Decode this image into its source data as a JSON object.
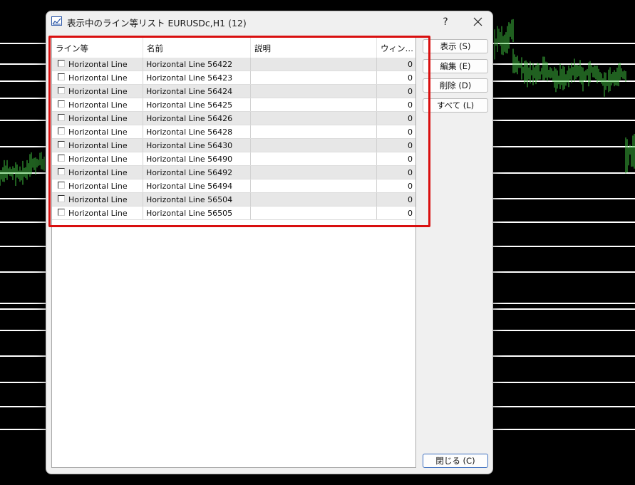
{
  "window": {
    "title": "表示中のライン等リスト EURUSDc,H1 (12)",
    "help_label": "?",
    "icon": "chart-window-icon",
    "close_icon": "close-icon"
  },
  "table": {
    "columns": [
      "ライン等",
      "名前",
      "説明",
      "ウィン…"
    ],
    "rows": [
      {
        "type": "Horizontal Line",
        "name": "Horizontal Line 56422",
        "desc": "",
        "window": "0"
      },
      {
        "type": "Horizontal Line",
        "name": "Horizontal Line 56423",
        "desc": "",
        "window": "0"
      },
      {
        "type": "Horizontal Line",
        "name": "Horizontal Line 56424",
        "desc": "",
        "window": "0"
      },
      {
        "type": "Horizontal Line",
        "name": "Horizontal Line 56425",
        "desc": "",
        "window": "0"
      },
      {
        "type": "Horizontal Line",
        "name": "Horizontal Line 56426",
        "desc": "",
        "window": "0"
      },
      {
        "type": "Horizontal Line",
        "name": "Horizontal Line 56428",
        "desc": "",
        "window": "0"
      },
      {
        "type": "Horizontal Line",
        "name": "Horizontal Line 56430",
        "desc": "",
        "window": "0"
      },
      {
        "type": "Horizontal Line",
        "name": "Horizontal Line 56490",
        "desc": "",
        "window": "0"
      },
      {
        "type": "Horizontal Line",
        "name": "Horizontal Line 56492",
        "desc": "",
        "window": "0"
      },
      {
        "type": "Horizontal Line",
        "name": "Horizontal Line 56494",
        "desc": "",
        "window": "0"
      },
      {
        "type": "Horizontal Line",
        "name": "Horizontal Line 56504",
        "desc": "",
        "window": "0"
      },
      {
        "type": "Horizontal Line",
        "name": "Horizontal Line 56505",
        "desc": "",
        "window": "0"
      }
    ]
  },
  "buttons": {
    "show": "表示 (S)",
    "edit": "編集 (E)",
    "delete": "削除 (D)",
    "all": "すべて (L)",
    "close": "閉じる (C)"
  },
  "colors": {
    "chart_background": "#000000",
    "chart_lines": "#ffffff",
    "price_bars": "#3fbf3f",
    "highlight": "#d90f0f",
    "default_button_border": "#3d6fbf"
  }
}
